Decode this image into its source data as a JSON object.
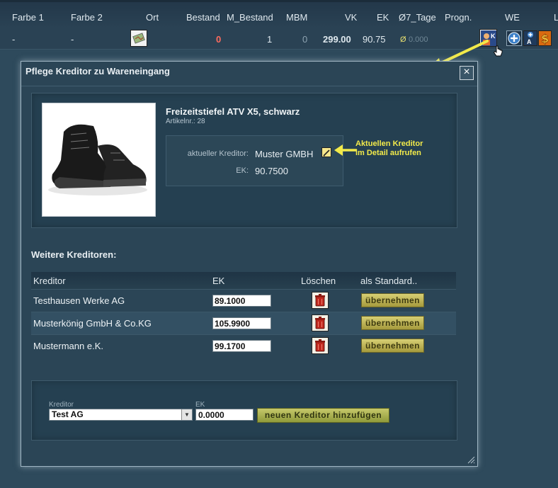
{
  "grid": {
    "headers": [
      "Farbe 1",
      "Farbe 2",
      "Ort",
      "Bestand",
      "M_Bestand",
      "MBM",
      "VK",
      "EK",
      "Ø7_Tage",
      "Progn.",
      "WE",
      "L"
    ],
    "row": {
      "farbe1": "-",
      "farbe2": "-",
      "bestand": "0",
      "m_bestand": "1",
      "mbm": "0",
      "vk": "299.00",
      "ek": "90.75",
      "avg_symbol": "Ø",
      "avg_value": "0.000"
    }
  },
  "modal": {
    "title": "Pflege Kreditor zu Wareneingang",
    "close": "×",
    "product": {
      "name": "Freizeitstiefel ATV X5, schwarz",
      "artnr": "Artikelnr.: 28"
    },
    "current": {
      "kreditor_label": "aktueller Kreditor:",
      "kreditor_value": "Muster GMBH",
      "ek_label": "EK:",
      "ek_value": "90.7500"
    },
    "callout": {
      "line1": "Aktuellen Kreditor",
      "line2": "im Detail aufrufen"
    },
    "weitere_title": "Weitere Kreditoren:",
    "table": {
      "headers": {
        "kreditor": "Kreditor",
        "ek": "EK",
        "loeschen": "Löschen",
        "standard": "als Standard.."
      },
      "rows": [
        {
          "name": "Testhausen Werke AG",
          "ek": "89.1000",
          "btn": "übernehmen"
        },
        {
          "name": "Musterkönig GmbH & Co.KG",
          "ek": "105.9900",
          "btn": "übernehmen"
        },
        {
          "name": "Mustermann e.K.",
          "ek": "99.1700",
          "btn": "übernehmen"
        }
      ]
    },
    "add": {
      "kreditor_label": "Kreditor",
      "kreditor_value": "Test AG",
      "ek_label": "EK",
      "ek_value": "0.0000",
      "button": "neuen Kreditor hinzufügen"
    }
  },
  "colors": {
    "accent_yellow": "#f2ea4a",
    "button_olive": "#c6c86a",
    "background": "#2e4a5c"
  }
}
